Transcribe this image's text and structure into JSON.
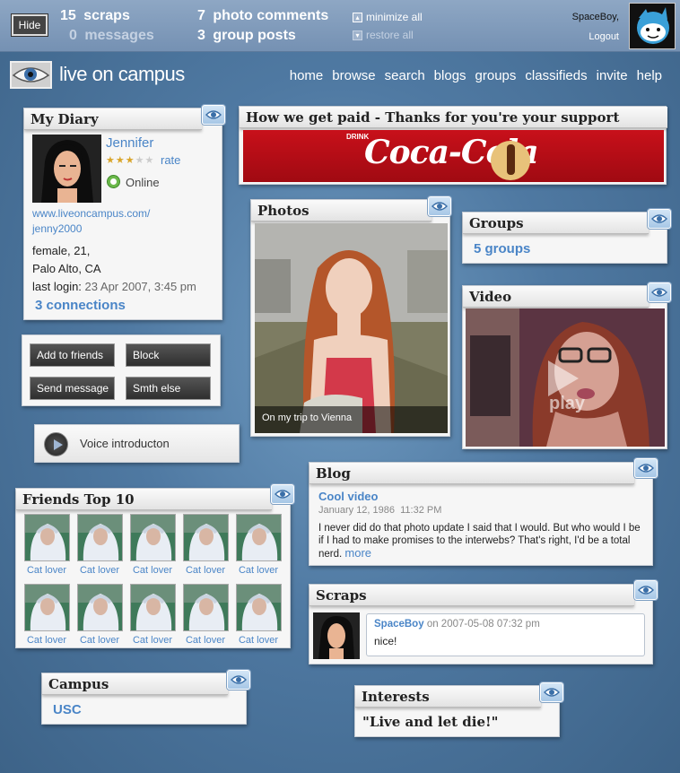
{
  "topbar": {
    "hide_label": "Hide",
    "scraps_count": "15",
    "scraps_label": "scraps",
    "messages_count": "0",
    "messages_label": "messages",
    "photo_comments_count": "7",
    "photo_comments_label": "photo comments",
    "group_posts_count": "3",
    "group_posts_label": "group posts",
    "minimize_label": "minimize all",
    "restore_label": "restore all",
    "username": "SpaceBoy,",
    "logout_label": "Logout"
  },
  "header": {
    "logo_text": "live on campus",
    "nav": [
      "home",
      "browse",
      "search",
      "blogs",
      "groups",
      "classifieds",
      "invite",
      "help"
    ]
  },
  "diary": {
    "title": "My Diary",
    "name": "Jennifer",
    "rate_label": "rate",
    "rating": 3,
    "rating_max": 5,
    "status": "Online",
    "url_line1": "www.liveoncampus.com/",
    "url_line2": "jenny2000",
    "info_line1": "female, 21,",
    "info_line2": "Palo Alto, CA",
    "last_login_label": "last login:",
    "last_login_value": "23 Apr 2007, 3:45 pm",
    "connections": "3 connections"
  },
  "actions": {
    "add_friends": "Add to friends",
    "block": "Block",
    "send_message": "Send message",
    "smth_else": "Smth else"
  },
  "voice": {
    "label": "Voice introducton"
  },
  "sponsor": {
    "title": "How we get paid - Thanks for you're your support",
    "ad_small": "DRINK",
    "ad_brand": "Coca-Cola"
  },
  "photos": {
    "title": "Photos",
    "caption": "On my trip to Vienna"
  },
  "groups": {
    "title": "Groups",
    "count_label": "5 groups"
  },
  "video": {
    "title": "Video",
    "play_label": "play"
  },
  "friends": {
    "title": "Friends Top 10",
    "items": [
      "Cat lover",
      "Cat lover",
      "Cat lover",
      "Cat lover",
      "Cat lover",
      "Cat lover",
      "Cat lover",
      "Cat lover",
      "Cat lover",
      "Cat lover"
    ]
  },
  "blog": {
    "title": "Blog",
    "post_title": "Cool video",
    "date": "January 12, 1986  11:32 PM",
    "body": "I never did do that photo update I said that I would. But who would I be if I had to make promises to the interwebs? That's right, I'd be a total nerd.",
    "more_label": "more"
  },
  "scraps": {
    "title": "Scraps",
    "author": "SpaceBoy",
    "meta": "on 2007-05-08 07:32 pm",
    "text": "nice!"
  },
  "campus": {
    "title": "Campus",
    "value": "USC"
  },
  "interests": {
    "title": "Interests",
    "quote": "\"Live and let die!\""
  },
  "colors": {
    "link": "#4a85c7",
    "accent_bg": "#4f79a2",
    "star": "#d9a52a"
  }
}
